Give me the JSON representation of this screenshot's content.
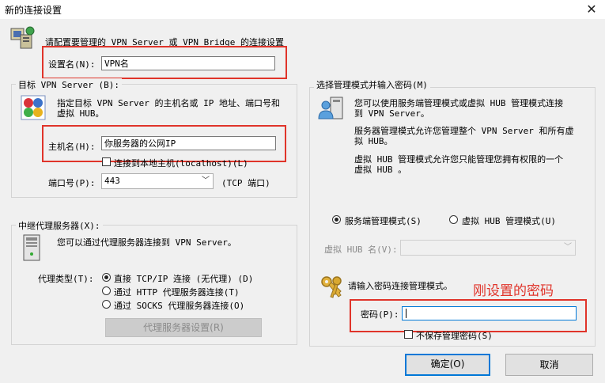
{
  "window": {
    "title": "新的连接设置"
  },
  "intro": {
    "text": "请配置要管理的 VPN Server 或 VPN Bridge 的连接设置"
  },
  "setting_name": {
    "label": "设置名(N):",
    "value": "VPN名"
  },
  "target": {
    "group_title": "目标 VPN Server (B):",
    "desc1": "指定目标 VPN Server 的主机名或 IP 地址、端口号和",
    "desc2": "虚拟 HUB。",
    "host_label": "主机名(H):",
    "host_value": "你服务器的公网IP",
    "localhost_label": "连接到本地主机(localhost)(L)",
    "port_label": "端口号(P):",
    "port_value": "443",
    "port_unit": "(TCP 端口)"
  },
  "proxy": {
    "group_title": "中继代理服务器(X):",
    "desc": "您可以通过代理服务器连接到 VPN Server。",
    "type_label": "代理类型(T):",
    "options": [
      "直接 TCP/IP 连接 (无代理) (D)",
      "通过 HTTP 代理服务器连接(T)",
      "通过 SOCKS 代理服务器连接(O)"
    ],
    "settings_button": "代理服务器设置(R)"
  },
  "mode": {
    "group_title": "选择管理模式并输入密码(M)",
    "p1_1": "您可以使用服务端管理模式或虚拟 HUB 管理模式连接",
    "p1_2": "到 VPN Server。",
    "p2_1": "服务器管理模式允许您管理整个 VPN Server 和所有虚",
    "p2_2": "拟 HUB。",
    "p3_1": "虚拟 HUB 管理模式允许您只能管理您拥有权限的一个",
    "p3_2": "虚拟 HUB 。",
    "server_mode": "服务端管理模式(S)",
    "hub_mode": "虚拟 HUB 管理模式(U)",
    "hub_name_label": "虚拟 HUB 名(V):",
    "hub_name_value": "",
    "password_prompt": "请输入密码连接管理模式。",
    "annotation": "刚设置的密码",
    "password_label": "密码(P):",
    "password_value": "",
    "no_save_label": "不保存管理密码(S)"
  },
  "buttons": {
    "ok": "确定(O)",
    "cancel": "取消"
  },
  "colors": {
    "highlight": "#e0342a",
    "focus": "#0078d7"
  }
}
